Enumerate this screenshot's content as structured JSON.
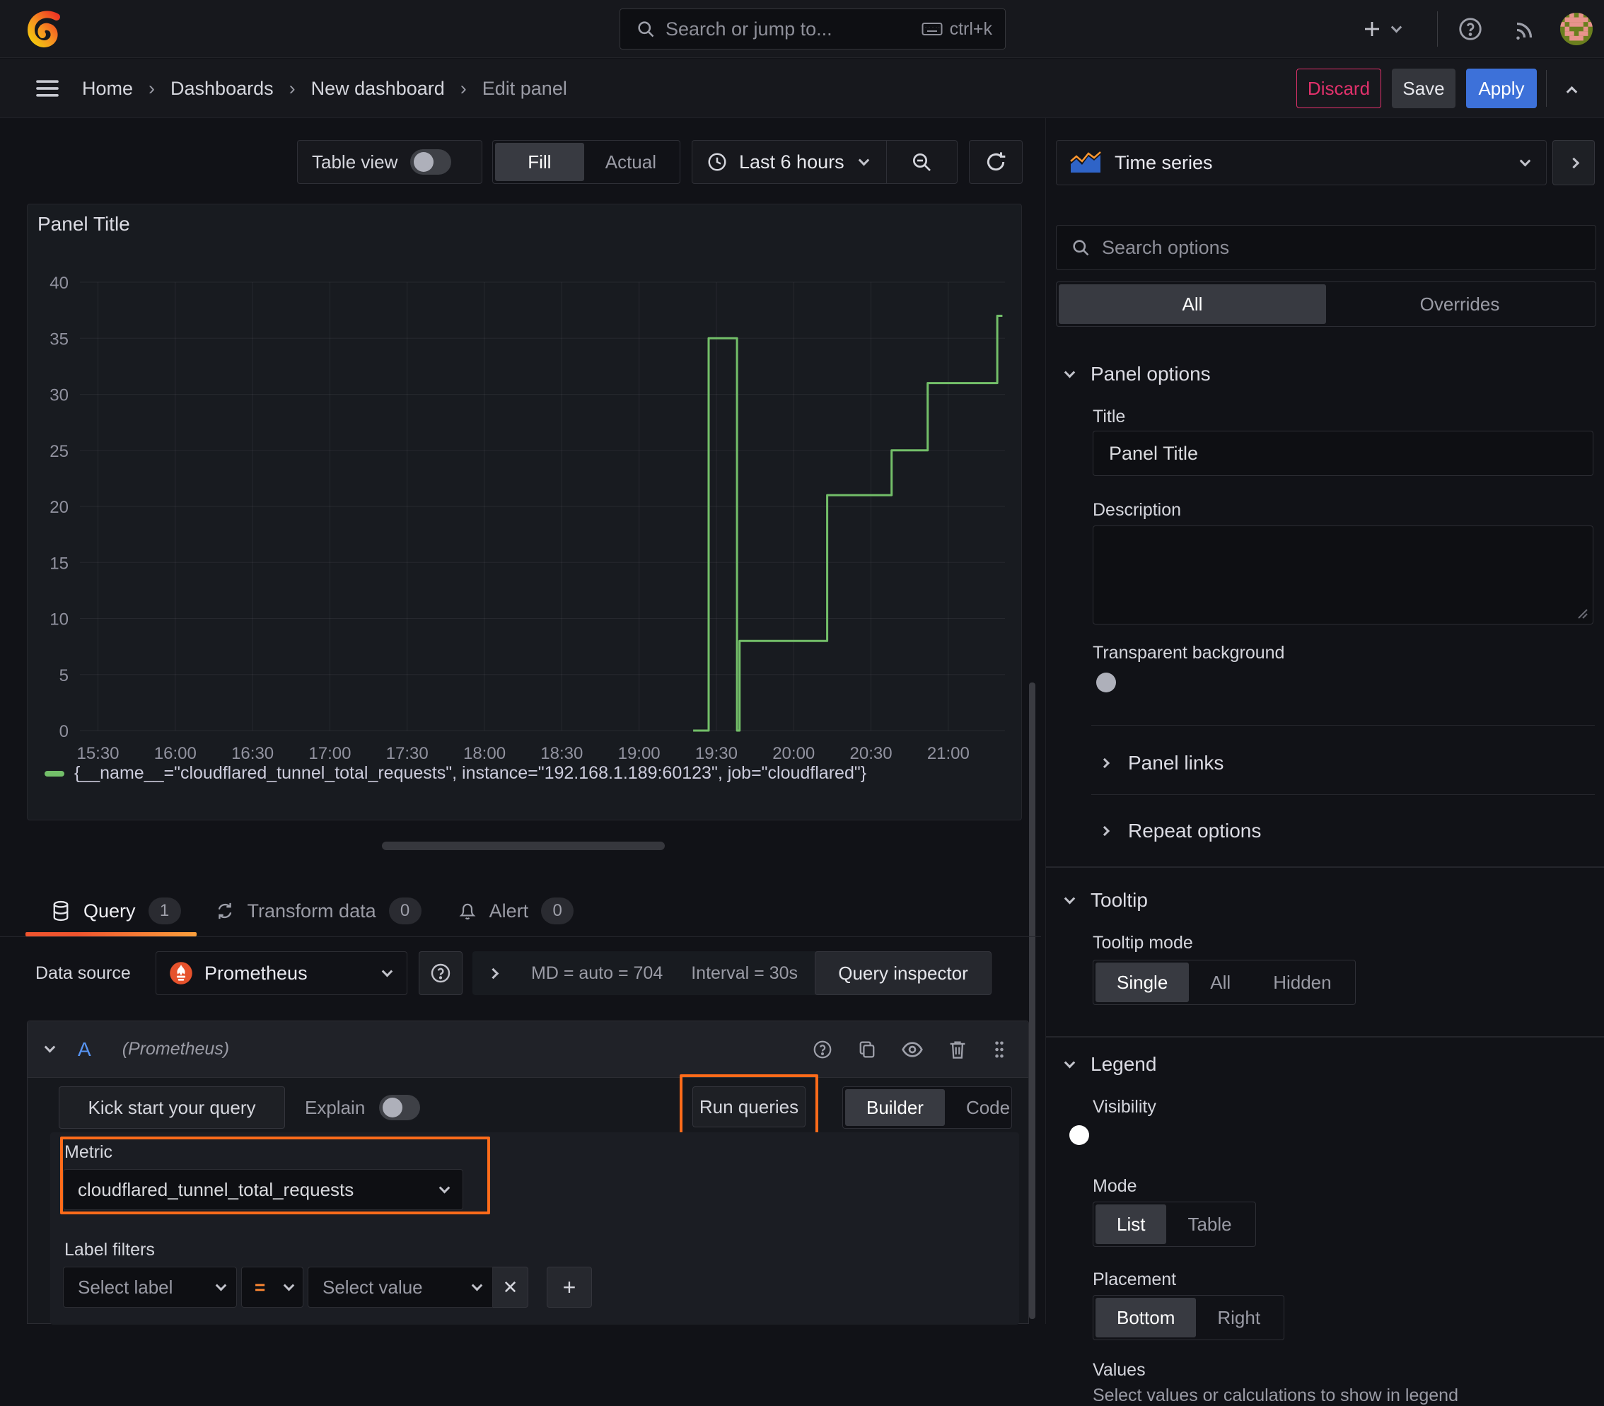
{
  "topnav": {
    "search_placeholder": "Search or jump to...",
    "search_shortcut": "ctrl+k"
  },
  "breadcrumb": {
    "items": [
      "Home",
      "Dashboards",
      "New dashboard",
      "Edit panel"
    ],
    "separator": "›",
    "discard_label": "Discard",
    "save_label": "Save",
    "apply_label": "Apply"
  },
  "panel_toolbar": {
    "table_view_label": "Table view",
    "fill_label": "Fill",
    "actual_label": "Actual",
    "time_range_label": "Last 6 hours"
  },
  "panel": {
    "title": "Panel Title",
    "legend_text": "{__name__=\"cloudflared_tunnel_total_requests\", instance=\"192.168.1.189:60123\", job=\"cloudflared\"}"
  },
  "chart_data": {
    "type": "line",
    "title": "Panel Title",
    "line_interpolation": "step-after",
    "grid": true,
    "legend_position": "bottom",
    "x_ticks": [
      "15:30",
      "16:00",
      "16:30",
      "17:00",
      "17:30",
      "18:00",
      "18:30",
      "19:00",
      "19:30",
      "20:00",
      "20:30",
      "21:00"
    ],
    "x_domain": [
      "15:23",
      "21:22"
    ],
    "y_ticks": [
      0,
      5,
      10,
      15,
      20,
      25,
      30,
      35,
      40
    ],
    "ylim": [
      0,
      40
    ],
    "series": [
      {
        "name": "{__name__=\"cloudflared_tunnel_total_requests\", instance=\"192.168.1.189:60123\", job=\"cloudflared\"}",
        "color": "#73bf69",
        "points": [
          [
            "19:21",
            0
          ],
          [
            "19:27",
            0
          ],
          [
            "19:27",
            35
          ],
          [
            "19:38",
            35
          ],
          [
            "19:38",
            0
          ],
          [
            "19:39",
            0
          ],
          [
            "19:39",
            8
          ],
          [
            "20:13",
            8
          ],
          [
            "20:13",
            21
          ],
          [
            "20:38",
            21
          ],
          [
            "20:38",
            25
          ],
          [
            "20:52",
            25
          ],
          [
            "20:52",
            31
          ],
          [
            "21:19",
            31
          ],
          [
            "21:19",
            37
          ],
          [
            "21:21",
            37
          ]
        ]
      }
    ]
  },
  "tabs": {
    "query_label": "Query",
    "query_count": "1",
    "transform_label": "Transform data",
    "transform_count": "0",
    "alert_label": "Alert",
    "alert_count": "0"
  },
  "datasource_row": {
    "label": "Data source",
    "value": "Prometheus",
    "stats_text": "MD = auto = 704",
    "interval_text": "Interval = 30s",
    "inspector_label": "Query inspector"
  },
  "query_editor": {
    "ref_id": "A",
    "ds_hint": "(Prometheus)",
    "kick_start_label": "Kick start your query",
    "explain_label": "Explain",
    "run_queries_label": "Run queries",
    "builder_label": "Builder",
    "code_label": "Code",
    "metric_label": "Metric",
    "metric_value": "cloudflared_tunnel_total_requests",
    "label_filters_label": "Label filters",
    "select_label_placeholder": "Select label",
    "operator_value": "=",
    "select_value_placeholder": "Select value"
  },
  "sidebar": {
    "viz_name": "Time series",
    "search_placeholder": "Search options",
    "tab_all": "All",
    "tab_overrides": "Overrides",
    "panel_options": {
      "heading": "Panel options",
      "title_label": "Title",
      "title_value": "Panel Title",
      "description_label": "Description",
      "transparent_label": "Transparent background"
    },
    "links_label": "Panel links",
    "repeat_label": "Repeat options",
    "tooltip": {
      "heading": "Tooltip",
      "mode_label": "Tooltip mode",
      "modes": [
        "Single",
        "All",
        "Hidden"
      ]
    },
    "legend": {
      "heading": "Legend",
      "visibility_label": "Visibility",
      "mode_label": "Mode",
      "modes": [
        "List",
        "Table"
      ],
      "placement_label": "Placement",
      "placements": [
        "Bottom",
        "Right"
      ],
      "values_label": "Values",
      "values_help": "Select values or calculations to show in legend"
    }
  },
  "icons_text": {
    "close": "✕",
    "add": "+",
    "plus": "+",
    "help": "?"
  },
  "colors": {
    "accent_orange": "#ff6b1a",
    "series_green": "#73bf69",
    "apply_blue": "#3d71d9",
    "discard_red": "#e0316b",
    "toggle_on_blue": "#3871dc",
    "ref_id_blue": "#5794f2",
    "tab_underline": "#f0542e"
  }
}
